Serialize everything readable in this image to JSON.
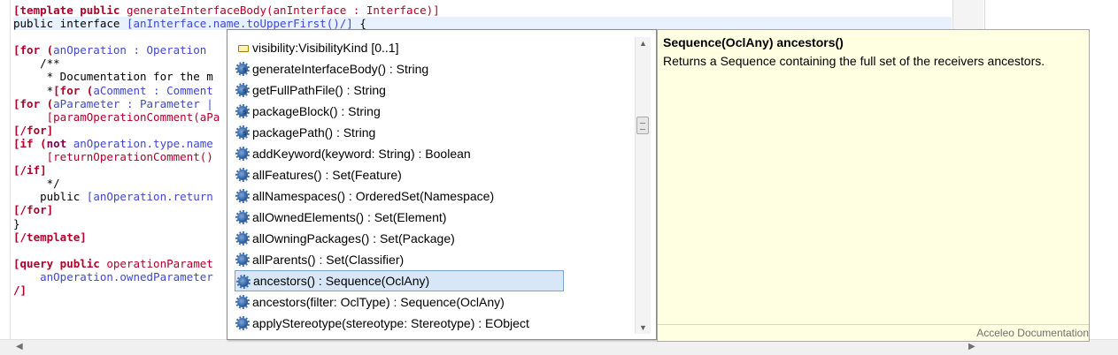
{
  "editor": {
    "lines": [
      [
        {
          "t": "[",
          "c": "tmpl-kw"
        },
        {
          "t": "template public ",
          "c": "tmpl-kw"
        },
        {
          "t": "generateInterfaceBody(anInterface : Interface)]",
          "c": "tpl"
        }
      ],
      [
        {
          "t": "public interface ",
          "c": ""
        },
        {
          "t": "[anInterface.name.toUpperFirst()/]",
          "c": "bl"
        },
        {
          "t": " {",
          "c": ""
        }
      ],
      [],
      [
        {
          "t": "[for (",
          "c": "tmpl-kw"
        },
        {
          "t": "anOperation : Operation",
          "c": "bl"
        }
      ],
      [
        {
          "t": "    /**",
          "c": ""
        }
      ],
      [
        {
          "t": "     * Documentation for the m",
          "c": ""
        }
      ],
      [
        {
          "t": "     *",
          "c": ""
        },
        {
          "t": "[for (",
          "c": "tmpl-kw"
        },
        {
          "t": "aComment : Comment",
          "c": "bl"
        }
      ],
      [
        {
          "t": "[for (",
          "c": "tmpl-kw"
        },
        {
          "t": "aParameter : Parameter |",
          "c": "bl"
        }
      ],
      [
        {
          "t": "     [",
          "c": "tpl"
        },
        {
          "t": "paramOperationComment(aPa",
          "c": "tpl"
        }
      ],
      [
        {
          "t": "[/for]",
          "c": "tmpl-kw"
        }
      ],
      [
        {
          "t": "[if (",
          "c": "tmpl-kw"
        },
        {
          "t": "not ",
          "c": "kw"
        },
        {
          "t": "anOperation.type.name",
          "c": "bl"
        }
      ],
      [
        {
          "t": "     [",
          "c": "tpl"
        },
        {
          "t": "returnOperationComment()",
          "c": "tpl"
        }
      ],
      [
        {
          "t": "[/if]",
          "c": "tmpl-kw"
        }
      ],
      [
        {
          "t": "     */",
          "c": ""
        }
      ],
      [
        {
          "t": "    public ",
          "c": ""
        },
        {
          "t": "[anOperation.return",
          "c": "bl"
        }
      ],
      [
        {
          "t": "[/for]",
          "c": "tmpl-kw"
        }
      ],
      [
        {
          "t": "}",
          "c": ""
        }
      ],
      [
        {
          "t": "[/template]",
          "c": "tmpl-kw"
        }
      ],
      [],
      [
        {
          "t": "[query public ",
          "c": "tmpl-kw"
        },
        {
          "t": "operationParamet",
          "c": "tpl"
        }
      ],
      [
        {
          "t": "    anOperation.ownedParameter",
          "c": "bl"
        }
      ],
      [
        {
          "t": "/]",
          "c": "tmpl-kw"
        }
      ]
    ]
  },
  "assist": {
    "items": [
      {
        "label": "visibility:VisibilityKind [0..1]",
        "icon": "field-icon",
        "selected": false
      },
      {
        "label": "generateInterfaceBody() : String",
        "icon": "template-operation-icon",
        "selected": false
      },
      {
        "label": "getFullPathFile() : String",
        "icon": "template-operation-icon",
        "selected": false
      },
      {
        "label": "packageBlock() : String",
        "icon": "template-operation-icon",
        "selected": false
      },
      {
        "label": "packagePath() : String",
        "icon": "template-operation-icon",
        "selected": false
      },
      {
        "label": "addKeyword(keyword: String) : Boolean",
        "icon": "operation-icon",
        "selected": false
      },
      {
        "label": "allFeatures() : Set(Feature)",
        "icon": "operation-icon",
        "selected": false
      },
      {
        "label": "allNamespaces() : OrderedSet(Namespace)",
        "icon": "operation-icon",
        "selected": false
      },
      {
        "label": "allOwnedElements() : Set(Element)",
        "icon": "operation-icon",
        "selected": false
      },
      {
        "label": "allOwningPackages() : Set(Package)",
        "icon": "operation-icon",
        "selected": false
      },
      {
        "label": "allParents() : Set(Classifier)",
        "icon": "operation-icon",
        "selected": false
      },
      {
        "label": "ancestors() : Sequence(OclAny)",
        "icon": "operation-icon",
        "selected": true
      },
      {
        "label": "ancestors(filter: OclType) : Sequence(OclAny)",
        "icon": "operation-icon",
        "selected": false
      },
      {
        "label": "applyStereotype(stereotype: Stereotype) : EObject",
        "icon": "operation-icon",
        "selected": false
      }
    ],
    "scroll_position": 0.15
  },
  "doc": {
    "title": "Sequence(OclAny) ancestors()",
    "body": "Returns a Sequence containing the full set of the receivers ancestors.",
    "footer": "Acceleo Documentation"
  }
}
